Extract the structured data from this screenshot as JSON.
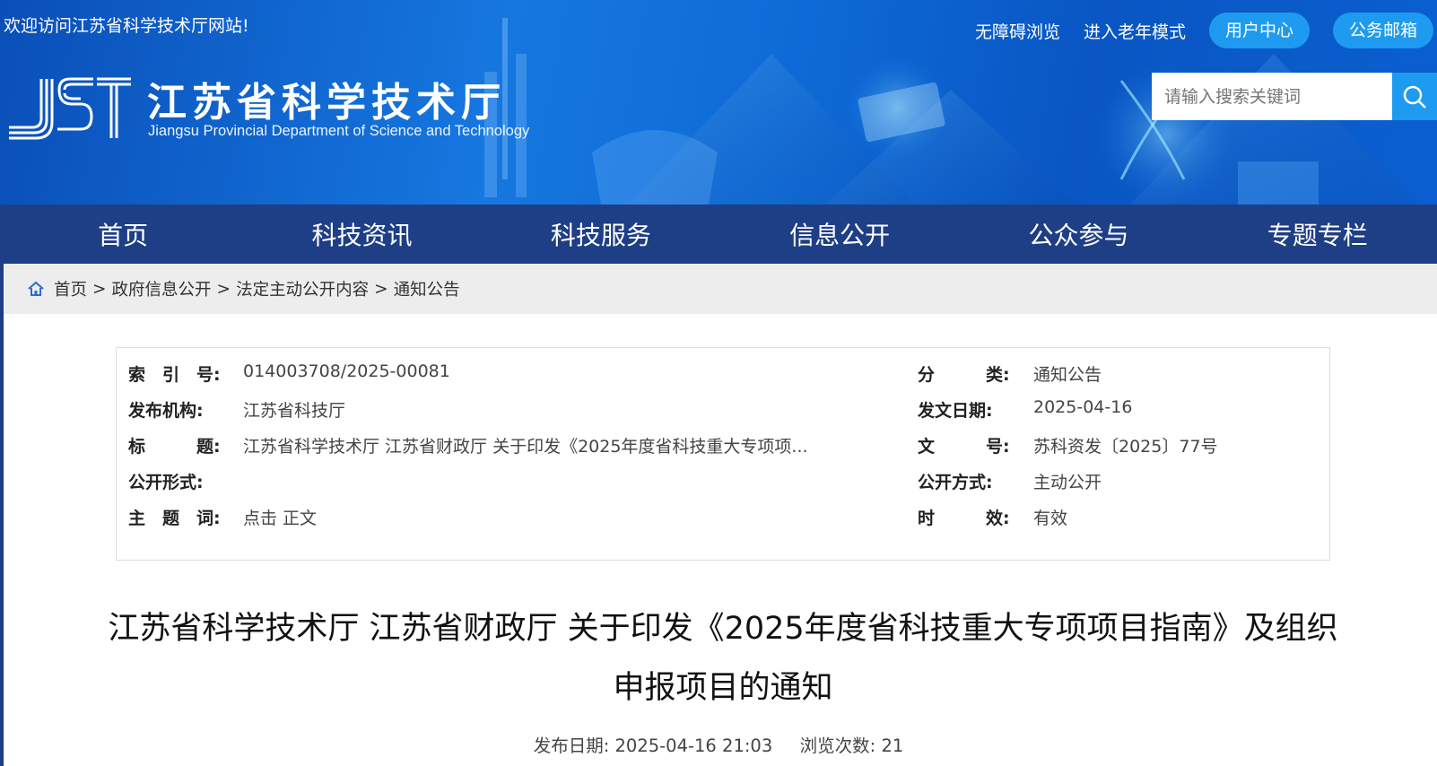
{
  "header": {
    "welcome": "欢迎访问江苏省科学技术厅网站!",
    "links": [
      "无障碍浏览",
      "进入老年模式"
    ],
    "pills": [
      "用户中心",
      "公务邮箱"
    ],
    "logo_cn": "江苏省科学技术厅",
    "logo_en": "Jiangsu Provincial Department of Science and Technology",
    "search_placeholder": "请输入搜索关键词"
  },
  "nav": [
    "首页",
    "科技资讯",
    "科技服务",
    "信息公开",
    "公众参与",
    "专题专栏"
  ],
  "breadcrumb": [
    "首页",
    "政府信息公开",
    "法定主动公开内容",
    "通知公告"
  ],
  "info": {
    "rows": [
      {
        "l_label": "索　引　号:",
        "l_value": "014003708/2025-00081",
        "r_label": "分　　　类:",
        "r_value": "通知公告"
      },
      {
        "l_label": "发布机构:",
        "l_value": "江苏省科技厅",
        "r_label": "发文日期:",
        "r_value": "2025-04-16"
      },
      {
        "l_label": "标　　　题:",
        "l_value": "江苏省科学技术厅 江苏省财政厅 关于印发《2025年度省科技重大专项项...",
        "r_label": "文　　　号:",
        "r_value": "苏科资发〔2025〕77号"
      },
      {
        "l_label": "公开形式:",
        "l_value": "",
        "r_label": "公开方式:",
        "r_value": "主动公开"
      },
      {
        "l_label": "主　题　词:",
        "l_value": "点击 正文",
        "r_label": "时　　　效:",
        "r_value": "有效"
      }
    ]
  },
  "article": {
    "title": "江苏省科学技术厅 江苏省财政厅 关于印发《2025年度省科技重大专项项目指南》及组织申报项目的通知",
    "date_label": "发布日期:",
    "date": "2025-04-16 21:03",
    "views_label": "浏览次数:",
    "views": "21"
  },
  "colors": {
    "banner": "#0e6ad6",
    "nav": "#1e3f86",
    "pill": "#1e9bf0",
    "crumb_bg": "#ededed"
  },
  "icons": [
    "search-icon",
    "home-icon",
    "jst-logo"
  ]
}
